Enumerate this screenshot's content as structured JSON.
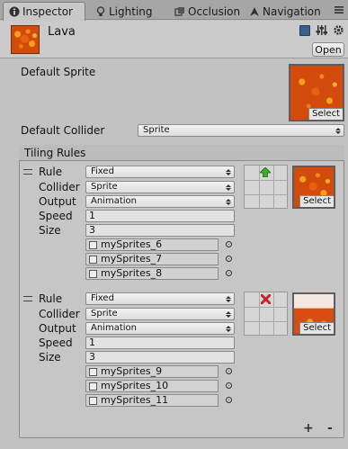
{
  "tabs": [
    {
      "label": "Inspector",
      "icon": "info-icon",
      "active": true
    },
    {
      "label": "Lighting",
      "icon": "lightbulb-icon",
      "active": false
    },
    {
      "label": "Occlusion",
      "icon": "occlusion-icon",
      "active": false
    },
    {
      "label": "Navigation",
      "icon": "navigation-icon",
      "active": false
    }
  ],
  "header": {
    "asset_name": "Lava",
    "open_label": "Open"
  },
  "default_sprite": {
    "label": "Default Sprite",
    "select_label": "Select"
  },
  "default_collider": {
    "label": "Default Collider",
    "value": "Sprite"
  },
  "tiling_rules": {
    "title": "Tiling Rules",
    "labels": {
      "rule": "Rule",
      "collider": "Collider",
      "output": "Output",
      "speed": "Speed",
      "size": "Size"
    },
    "rules": [
      {
        "rule": "Fixed",
        "collider": "Sprite",
        "output": "Animation",
        "speed": "1",
        "size": "3",
        "sprites": [
          "mySprites_6",
          "mySprites_7",
          "mySprites_8"
        ],
        "neighbor_icon": "green-arrow-up-icon",
        "select_label": "Select"
      },
      {
        "rule": "Fixed",
        "collider": "Sprite",
        "output": "Animation",
        "speed": "1",
        "size": "3",
        "sprites": [
          "mySprites_9",
          "mySprites_10",
          "mySprites_11"
        ],
        "neighbor_icon": "red-x-icon",
        "select_label": "Select"
      }
    ]
  },
  "footer": {
    "add": "+",
    "remove": "-"
  },
  "colors": {
    "accent_green": "#3fae2a",
    "accent_red": "#c8232b",
    "lava": "#d24a0c"
  }
}
